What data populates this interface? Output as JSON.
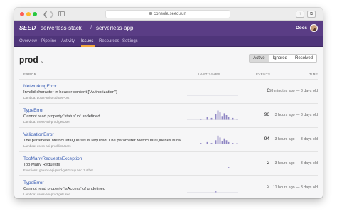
{
  "browser": {
    "url": "console.seed.run"
  },
  "header": {
    "logo": "SEED",
    "org": "serverless-stack",
    "app": "serverless-app",
    "docs": "Docs"
  },
  "tabs": [
    "Overview",
    "Pipeline",
    "Activity",
    "Issues",
    "Resources",
    "Settings"
  ],
  "active_tab": "Issues",
  "stage": "prod",
  "filters": [
    "Active",
    "Ignored",
    "Resolved"
  ],
  "active_filter": "Active",
  "table": {
    "headers": {
      "error": "ERROR",
      "last": "LAST 24HRS",
      "events": "EVENTS",
      "time": "TIME"
    },
    "rows": [
      {
        "name": "NetworkingError",
        "message": "Invalid character in header content [\"Authorization\"]",
        "source": "Lambda: posts-api-prod-getPost",
        "events": "6",
        "time": "58 minutes ago — 3 days old",
        "spark": [
          0,
          0,
          0,
          0,
          0,
          0,
          0,
          0,
          0,
          0,
          0,
          0,
          0,
          0,
          0,
          0,
          0,
          0,
          0,
          0,
          0,
          0,
          0,
          0
        ]
      },
      {
        "name": "TypeError",
        "message": "Cannot read property 'status' of undefined",
        "source": "Lambda: users-api-prod-getUser",
        "events": "96",
        "time": "3 hours ago — 3 days old",
        "spark": [
          0,
          0,
          0,
          0,
          0,
          0,
          1,
          0,
          0,
          3,
          0,
          2,
          0,
          6,
          10,
          8,
          4,
          7,
          5,
          3,
          0,
          2,
          0,
          1
        ]
      },
      {
        "name": "ValidationError",
        "message": "The parameter MetricDataQueries is required. The parameter MetricDataQueries is req...",
        "source": "Lambda: users-api-prod-listUsers",
        "events": "94",
        "time": "3 hours ago — 3 days old",
        "spark": [
          0,
          0,
          0,
          0,
          0,
          0,
          1,
          0,
          0,
          2,
          0,
          1,
          0,
          4,
          9,
          7,
          3,
          6,
          4,
          2,
          0,
          1,
          0,
          1
        ]
      },
      {
        "name": "TooManyRequestsException",
        "message": "Too Many Requests",
        "source": "Functions: groups-api-prod-getGroup and 1 other",
        "events": "2",
        "time": "3 hours ago — 3 days old",
        "spark": [
          0,
          0,
          0,
          0,
          0,
          0,
          0,
          0,
          0,
          0,
          0,
          0,
          0,
          0,
          0,
          0,
          0,
          0,
          0,
          1,
          0,
          0,
          0,
          0
        ]
      },
      {
        "name": "TypeError",
        "message": "Cannot read property 'isAccess' of undefined",
        "source": "Lambda: users-api-prod-getUser",
        "events": "2",
        "time": "11 hours ago — 3 days old",
        "spark": [
          0,
          0,
          0,
          0,
          0,
          0,
          0,
          0,
          0,
          0,
          0,
          0,
          0,
          1,
          0,
          0,
          0,
          0,
          0,
          0,
          0,
          0,
          0,
          0
        ]
      }
    ]
  }
}
